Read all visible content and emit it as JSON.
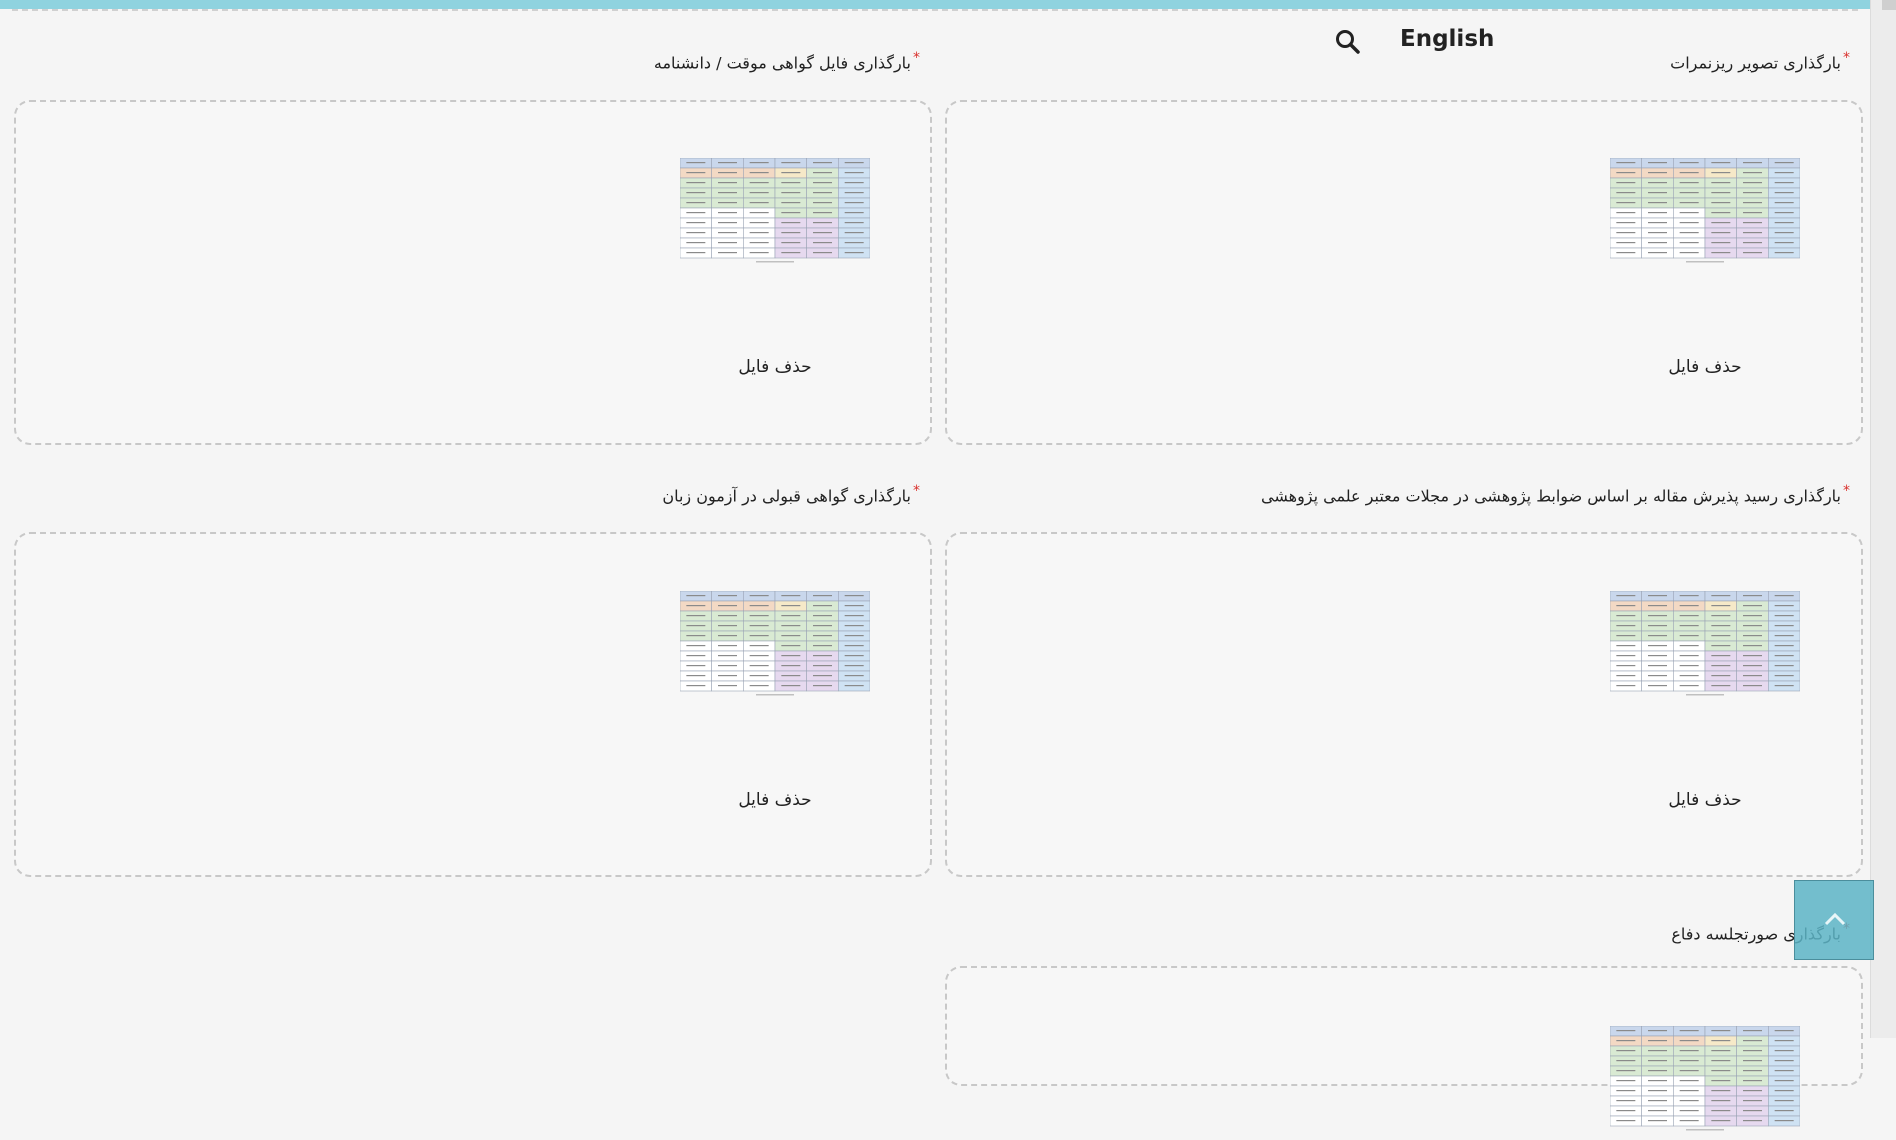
{
  "header": {
    "language_link": "English",
    "search_icon": "search-icon"
  },
  "uploads": [
    {
      "label": "بارگذاری تصویر ریزنمرات",
      "required": true,
      "delete_label": "حذف فایل"
    },
    {
      "label": "بارگذاری فایل گواهی موقت / دانشنامه",
      "required": true,
      "delete_label": "حذف فایل"
    },
    {
      "label": "بارگذاری رسید پذیرش مقاله بر اساس ضوابط پژوهشی در مجلات معتبر علمی پژوهشی",
      "required": true,
      "delete_label": "حذف فایل"
    },
    {
      "label": "بارگذاری گواهی قبولی در آزمون زبان",
      "required": true,
      "delete_label": "حذف فایل"
    },
    {
      "label": "بارگذاری صورتجلسه دفاع",
      "required": true,
      "delete_label": ""
    }
  ],
  "back_to_top_icon": "chevron-up-icon",
  "colors": {
    "top_strip": "#8fd3df",
    "required_star": "#d9302c",
    "back_to_top": "#5cb4c5"
  }
}
